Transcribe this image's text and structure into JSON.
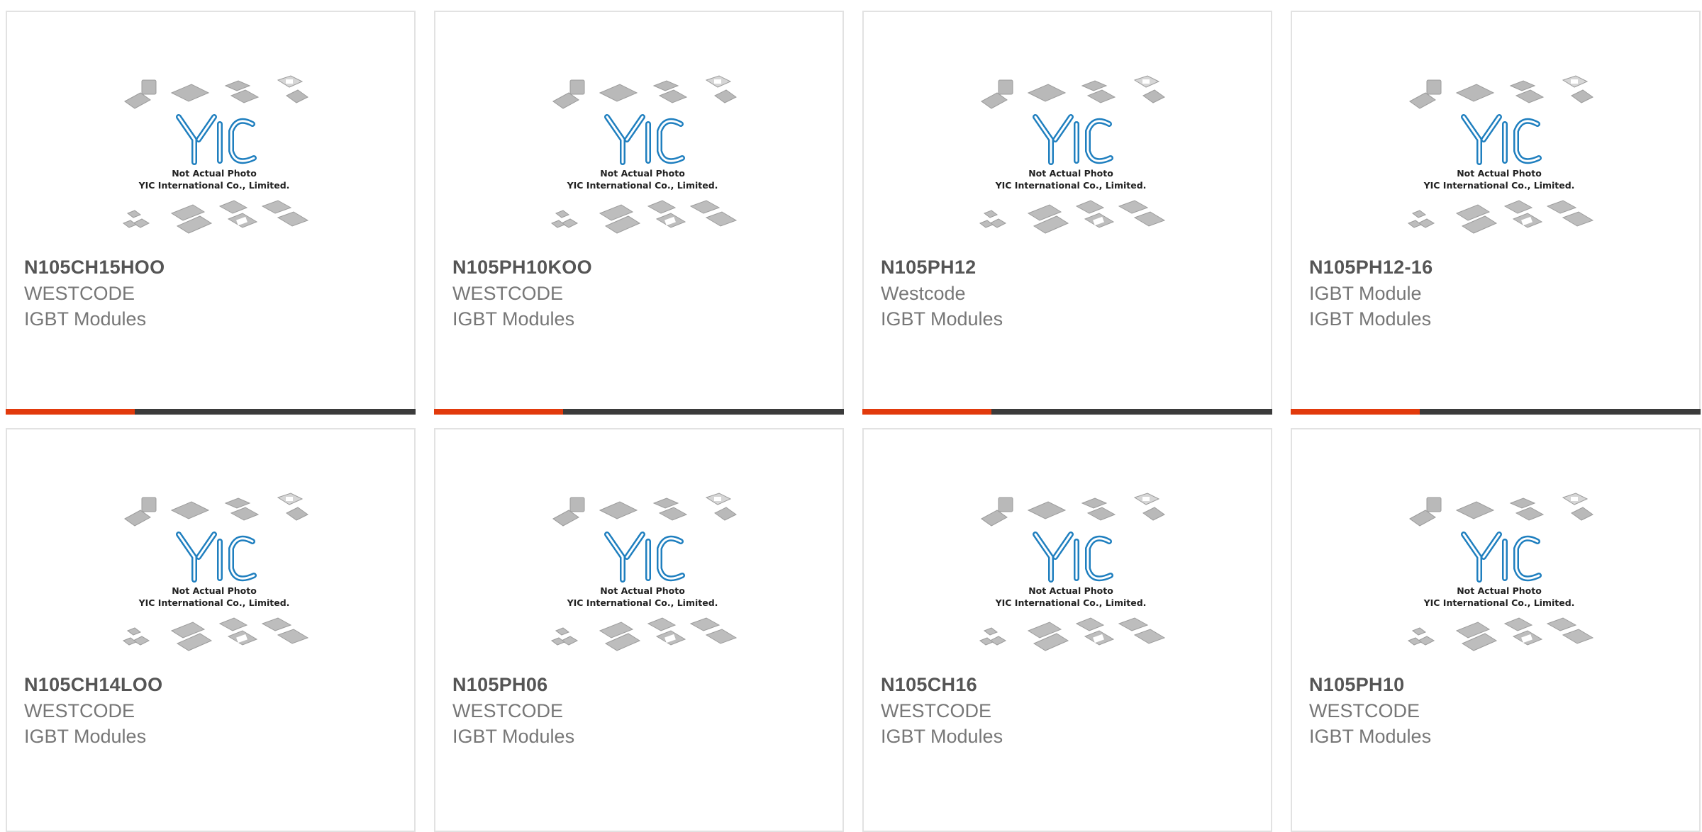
{
  "accent_color": "#e23a0c",
  "bar_color": "#3b3b3b",
  "placeholder": {
    "line1": "Not Actual Photo",
    "line2": "YIC International Co., Limited.",
    "logo_text": "YIC"
  },
  "products": [
    {
      "part_number": "N105CH15HOO",
      "manufacturer": "WESTCODE",
      "category": "IGBT Modules"
    },
    {
      "part_number": "N105PH10KOO",
      "manufacturer": "WESTCODE",
      "category": "IGBT Modules"
    },
    {
      "part_number": "N105PH12",
      "manufacturer": "Westcode",
      "category": "IGBT Modules"
    },
    {
      "part_number": "N105PH12-16",
      "manufacturer": "IGBT Module",
      "category": "IGBT Modules"
    },
    {
      "part_number": "N105CH14LOO",
      "manufacturer": "WESTCODE",
      "category": "IGBT Modules"
    },
    {
      "part_number": "N105PH06",
      "manufacturer": "WESTCODE",
      "category": "IGBT Modules"
    },
    {
      "part_number": "N105CH16",
      "manufacturer": "WESTCODE",
      "category": "IGBT Modules"
    },
    {
      "part_number": "N105PH10",
      "manufacturer": "WESTCODE",
      "category": "IGBT Modules"
    }
  ]
}
